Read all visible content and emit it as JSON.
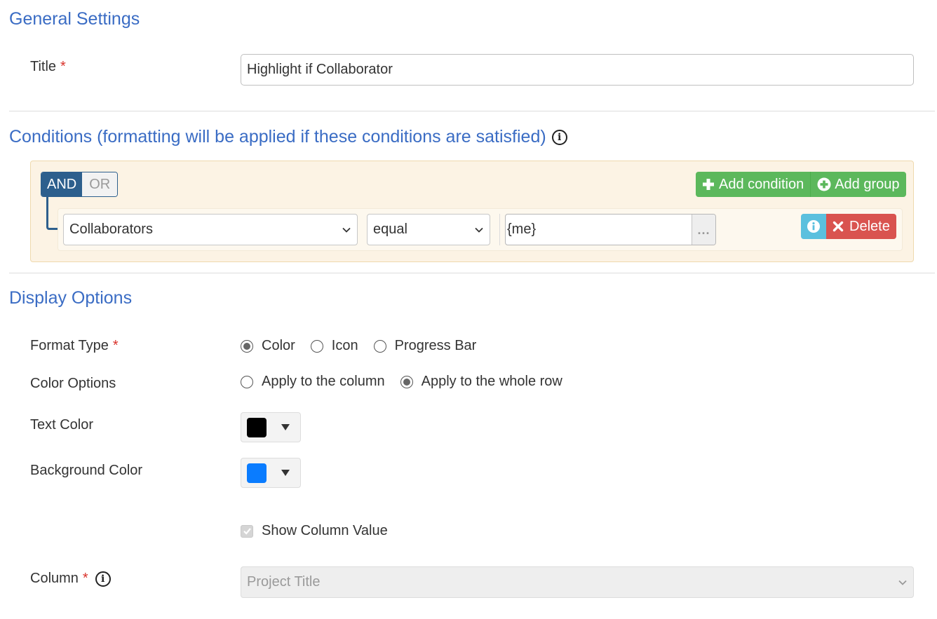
{
  "general": {
    "heading": "General Settings",
    "title_label": "Title",
    "required_mark": "*",
    "title_value": "Highlight if Collaborator"
  },
  "conditions": {
    "heading": "Conditions (formatting will be applied if these conditions are satisfied)",
    "logic": {
      "and_label": "AND",
      "or_label": "OR",
      "selected": "AND"
    },
    "add_condition_label": "Add condition",
    "add_group_label": "Add group",
    "rule": {
      "field": "Collaborators",
      "operator": "equal",
      "value": "{me}",
      "more_label": "...",
      "delete_label": "Delete"
    }
  },
  "display": {
    "heading": "Display Options",
    "format_type_label": "Format Type",
    "format_type_options": [
      "Color",
      "Icon",
      "Progress Bar"
    ],
    "format_type_selected": "Color",
    "color_options_label": "Color Options",
    "color_options": [
      "Apply to the column",
      "Apply to the whole row"
    ],
    "color_option_selected": "Apply to the whole row",
    "text_color_label": "Text Color",
    "text_color_value": "#000000",
    "background_color_label": "Background Color",
    "background_color_value": "#0a7cff",
    "show_column_value_label": "Show Column Value",
    "show_column_value_checked": true,
    "column_label": "Column",
    "column_value": "Project Title"
  },
  "colors": {
    "heading": "#3a6cc4",
    "and_active": "#2d5f8d",
    "add_green": "#5cb85c",
    "info_blue": "#5bc0de",
    "delete_red": "#d9534f",
    "required": "#d9322b"
  }
}
